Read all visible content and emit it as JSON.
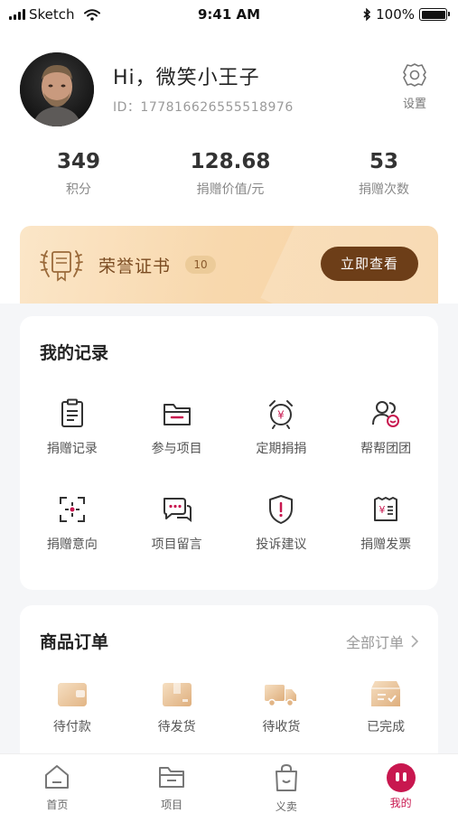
{
  "status_bar": {
    "carrier": "Sketch",
    "time": "9:41 AM",
    "battery": "100%"
  },
  "profile": {
    "greeting": "Hi，微笑小王子",
    "user_id": "ID：177816626555518976",
    "settings_label": "设置"
  },
  "stats": [
    {
      "value": "349",
      "label": "积分"
    },
    {
      "value": "128.68",
      "label": "捐赠价值/元"
    },
    {
      "value": "53",
      "label": "捐赠次数"
    }
  ],
  "honor": {
    "title": "荣誉证书",
    "count": "10",
    "button": "立即查看"
  },
  "records": {
    "title": "我的记录",
    "items": [
      {
        "label": "捐赠记录",
        "icon": "clipboard-icon"
      },
      {
        "label": "参与项目",
        "icon": "folder-icon"
      },
      {
        "label": "定期捐捐",
        "icon": "alarm-clock-icon"
      },
      {
        "label": "帮帮团团",
        "icon": "group-icon"
      },
      {
        "label": "捐赠意向",
        "icon": "target-focus-icon"
      },
      {
        "label": "项目留言",
        "icon": "chat-bubbles-icon"
      },
      {
        "label": "投诉建议",
        "icon": "shield-alert-icon"
      },
      {
        "label": "捐赠发票",
        "icon": "receipt-icon"
      }
    ]
  },
  "orders": {
    "title": "商品订单",
    "all_link": "全部订单",
    "items": [
      {
        "label": "待付款",
        "icon": "wallet-icon"
      },
      {
        "label": "待发货",
        "icon": "box-icon"
      },
      {
        "label": "待收货",
        "icon": "truck-icon"
      },
      {
        "label": "已完成",
        "icon": "completed-box-icon"
      }
    ]
  },
  "tabbar": [
    {
      "label": "首页",
      "icon": "home-icon"
    },
    {
      "label": "项目",
      "icon": "project-folder-icon"
    },
    {
      "label": "义卖",
      "icon": "shopping-bag-icon"
    },
    {
      "label": "我的",
      "icon": "profile-face-icon",
      "active": true
    }
  ],
  "colors": {
    "accent": "#c8174f",
    "brown": "#6d3e18",
    "gold_light": "#fbe6c8"
  }
}
